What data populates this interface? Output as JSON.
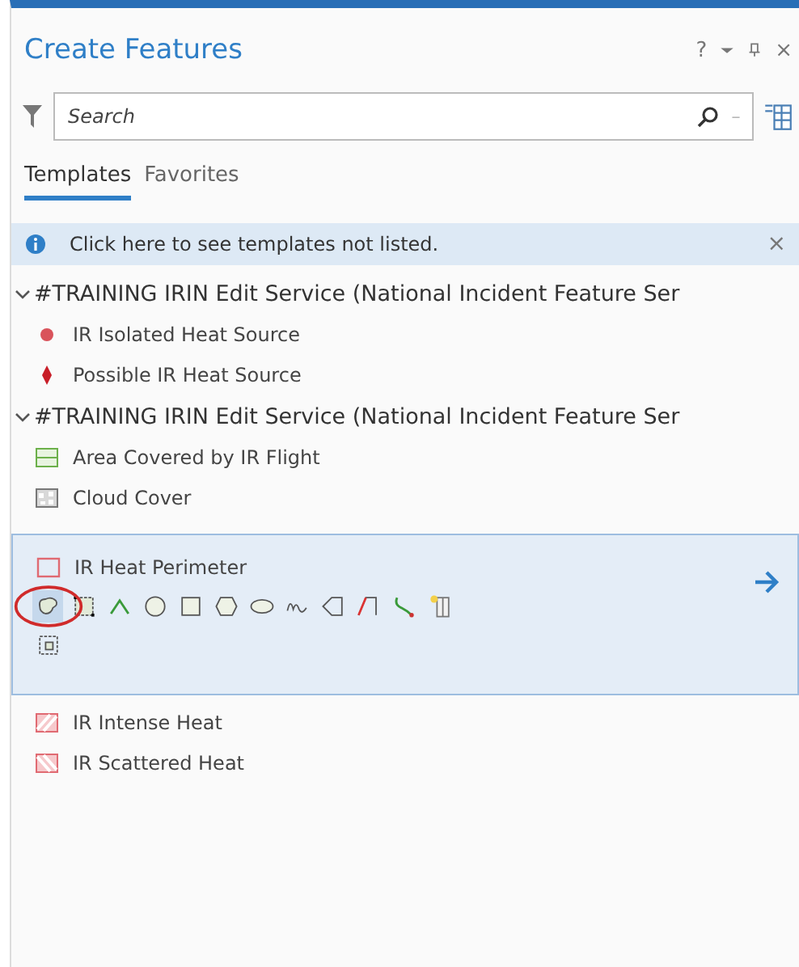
{
  "pane": {
    "title": "Create Features",
    "help": "?",
    "close": "×"
  },
  "search": {
    "placeholder": "Search"
  },
  "tabs": [
    {
      "label": "Templates",
      "selected": true
    },
    {
      "label": "Favorites",
      "selected": false
    }
  ],
  "notice": {
    "text": "Click here to see templates not listed.",
    "close": "×"
  },
  "groups": [
    {
      "title": "#TRAINING IRIN Edit Service (National Incident Feature Ser",
      "expanded": true,
      "templates": [
        {
          "name": "IR Isolated Heat Source",
          "kind": "dot",
          "selected": false
        },
        {
          "name": "Possible IR Heat Source",
          "kind": "diamond",
          "selected": false
        }
      ]
    },
    {
      "title": "#TRAINING IRIN Edit Service (National Incident Feature Ser",
      "expanded": true,
      "templates": [
        {
          "name": "Area Covered by IR Flight",
          "kind": "green-box",
          "selected": false
        },
        {
          "name": "Cloud Cover",
          "kind": "cloud-box",
          "selected": false
        },
        {
          "name": "IR Heat Perimeter",
          "kind": "red-box",
          "selected": true,
          "tools": [
            {
              "kind": "freehand",
              "selected": true
            },
            {
              "kind": "rect-select",
              "selected": false
            },
            {
              "kind": "vertex",
              "selected": false
            },
            {
              "kind": "circle",
              "selected": false
            },
            {
              "kind": "square",
              "selected": false
            },
            {
              "kind": "hexagon",
              "selected": false
            },
            {
              "kind": "ellipse",
              "selected": false
            },
            {
              "kind": "squiggle",
              "selected": false
            },
            {
              "kind": "trace",
              "selected": false
            },
            {
              "kind": "right-angle",
              "selected": false
            },
            {
              "kind": "stream",
              "selected": false
            },
            {
              "kind": "autocomplete",
              "selected": false
            },
            {
              "kind": "grid",
              "selected": false
            }
          ]
        },
        {
          "name": "IR Intense Heat",
          "kind": "hatch-right",
          "selected": false
        },
        {
          "name": "IR Scattered Heat",
          "kind": "hatch-left",
          "selected": false
        }
      ]
    }
  ]
}
